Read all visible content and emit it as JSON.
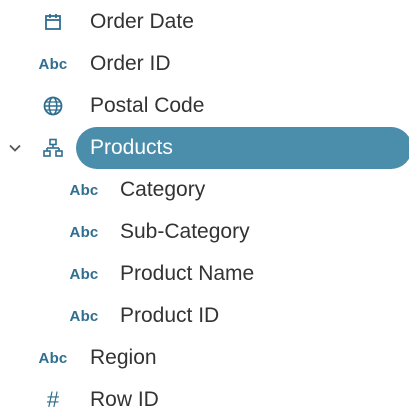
{
  "fields": [
    {
      "label": "Order Date",
      "icon": "calendar-icon",
      "level": 0
    },
    {
      "label": "Order ID",
      "icon": "abc-icon",
      "icon_text": "Abc",
      "level": 0
    },
    {
      "label": "Postal Code",
      "icon": "globe-icon",
      "level": 0
    },
    {
      "label": "Products",
      "icon": "hierarchy-icon",
      "level": 0,
      "selected": true,
      "expanded": true
    },
    {
      "label": "Category",
      "icon": "abc-icon",
      "icon_text": "Abc",
      "level": 1
    },
    {
      "label": "Sub-Category",
      "icon": "abc-icon",
      "icon_text": "Abc",
      "level": 1
    },
    {
      "label": "Product Name",
      "icon": "abc-icon",
      "icon_text": "Abc",
      "level": 1
    },
    {
      "label": "Product ID",
      "icon": "abc-icon",
      "icon_text": "Abc",
      "level": 1
    },
    {
      "label": "Region",
      "icon": "abc-icon",
      "icon_text": "Abc",
      "level": 0
    },
    {
      "label": "Row ID",
      "icon": "hash-icon",
      "icon_text": "#",
      "level": 0
    }
  ],
  "colors": {
    "icon": "#2f6e8f",
    "selection": "#4a8eab",
    "text": "#333333",
    "selected_text": "#ffffff"
  }
}
